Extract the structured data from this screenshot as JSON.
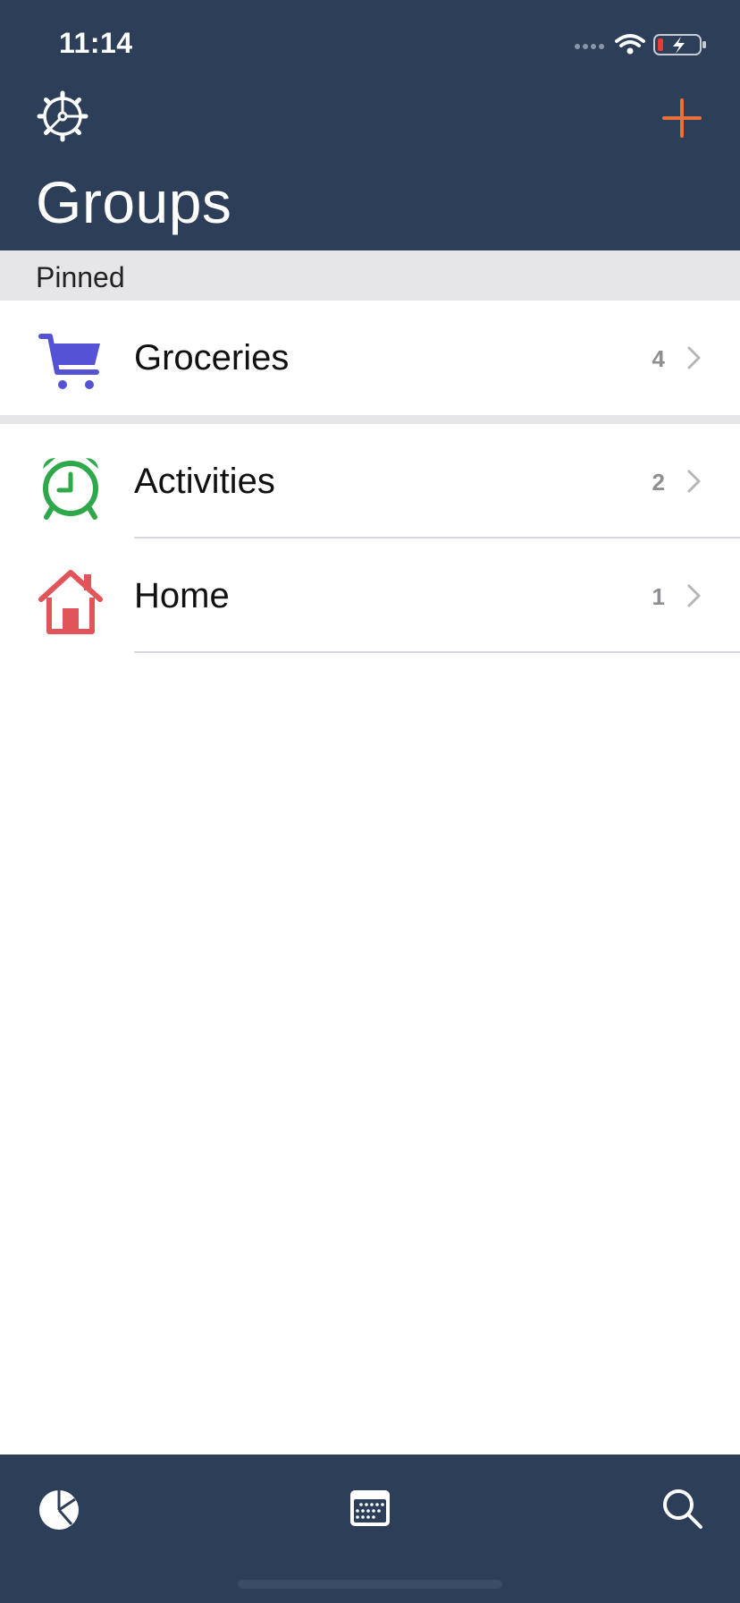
{
  "status_bar": {
    "time": "11:14"
  },
  "header": {
    "title": "Groups"
  },
  "section": {
    "label": "Pinned"
  },
  "pinned_group": {
    "label": "Groceries",
    "count": "4",
    "icon": "cart-icon",
    "color": "#5552d6"
  },
  "groups": [
    {
      "label": "Activities",
      "count": "2",
      "icon": "alarm-clock-icon",
      "color": "#2ea84a"
    },
    {
      "label": "Home",
      "count": "1",
      "icon": "house-icon",
      "color": "#e0545a"
    }
  ],
  "colors": {
    "navy": "#2d3e58",
    "accent": "#e8703a"
  },
  "tabbar": {
    "items": [
      "pie-chart-icon",
      "calendar-icon",
      "search-icon"
    ]
  }
}
